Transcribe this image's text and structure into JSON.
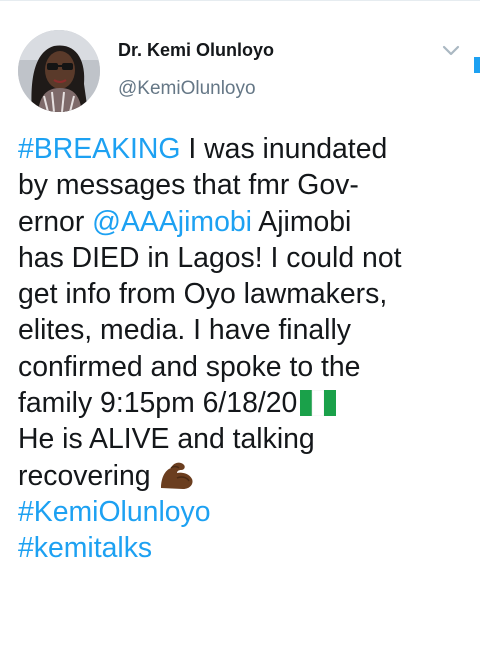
{
  "user": {
    "display_name": "Dr. Kemi Olunloyo",
    "handle": "@KemiOlunloyo"
  },
  "tweet": {
    "line1_hashtag": "#BREAKING",
    "line1_text": " I was inundated",
    "line2": "by messages that fmr Gov-",
    "line3_prefix": "ernor ",
    "line3_mention": "@AAAjimobi",
    "line3_text": " Ajimobi",
    "line4": "has DIED in Lagos! I could not",
    "line5": "get info from Oyo lawmakers,",
    "line6": "elites, media. I have finally",
    "line7": "confirmed and spoke to the",
    "line8": "family 9:15pm 6/18/20",
    "line9": "He is ALIVE and talking",
    "line10": "recovering",
    "hashtag_1": "#KemiOlunloyo",
    "hashtag_2": "#kemitalks"
  },
  "icons": {
    "menu": "chevron-down-icon",
    "flag": "nigeria-flag-emoji",
    "muscle": "flexed-biceps-emoji"
  },
  "colors": {
    "link": "#1da1f2",
    "text": "#14171a",
    "secondary": "#657786"
  }
}
